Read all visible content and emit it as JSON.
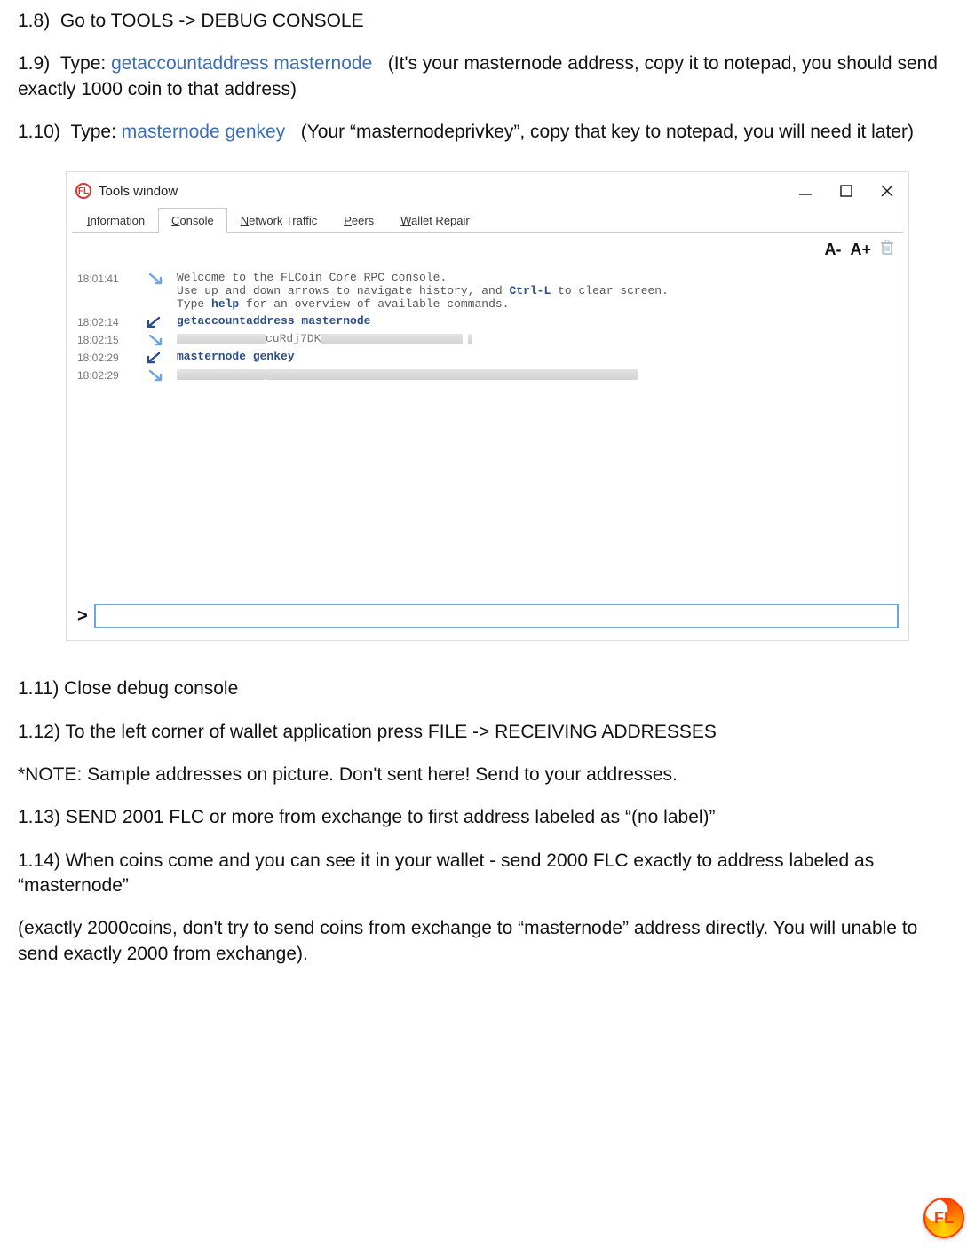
{
  "instructions": {
    "s1_8": {
      "num": "1.8)",
      "text": "Go to TOOLS -> DEBUG CONSOLE"
    },
    "s1_9": {
      "num": "1.9)",
      "lead": "Type:",
      "cmd": "getaccountaddress masternode",
      "tail": "(It's your masternode address, copy it to notepad, you should send exactly 1000 coin to that address)"
    },
    "s1_10": {
      "num": "1.10)",
      "lead": "Type:",
      "cmd": "masternode genkey",
      "tail": "(Your “masternodeprivkey”, copy that key to notepad, you will need it later)"
    },
    "s1_11": "1.11) Close debug console",
    "s1_12": "1.12) To the left corner of wallet application press FILE -> RECEIVING ADDRESSES",
    "note": "*NOTE: Sample addresses on picture. Don't sent here! Send to your addresses.",
    "s1_13": "1.13) SEND 2001 FLC or more from exchange to first address labeled as “(no label)”",
    "s1_14": "1.14) When coins come and you can see it in your wallet - send 2000 FLC exactly to address labeled as “masternode”",
    "s1_14b": "(exactly 2000coins, don't try to send coins from exchange to “masternode” address directly. You will unable to send exactly 2000 from exchange)."
  },
  "tools_window": {
    "title": "Tools window",
    "logo_text": "FL",
    "tabs": [
      "Information",
      "Console",
      "Network Traffic",
      "Peers",
      "Wallet Repair"
    ],
    "active_tab": 1,
    "toolbar": {
      "dec": "A-",
      "inc": "A+"
    },
    "log": [
      {
        "ts": "18:01:41",
        "dir": "out",
        "text": "Welcome to the FLCoin Core RPC console.\nUse up and down arrows to navigate history, and Ctrl-L to clear screen.\nType help for an overview of available commands.",
        "kw": [
          "Ctrl-L",
          "help"
        ]
      },
      {
        "ts": "18:02:14",
        "dir": "in",
        "text": "getaccountaddress masternode"
      },
      {
        "ts": "18:02:15",
        "dir": "out",
        "redacted": true,
        "visible": "cuRdj7DK"
      },
      {
        "ts": "18:02:29",
        "dir": "in",
        "text": "masternode genkey"
      },
      {
        "ts": "18:02:29",
        "dir": "out",
        "redacted": true,
        "visible": ""
      }
    ],
    "prompt": ">",
    "input_value": ""
  },
  "corner_logo": "FL"
}
